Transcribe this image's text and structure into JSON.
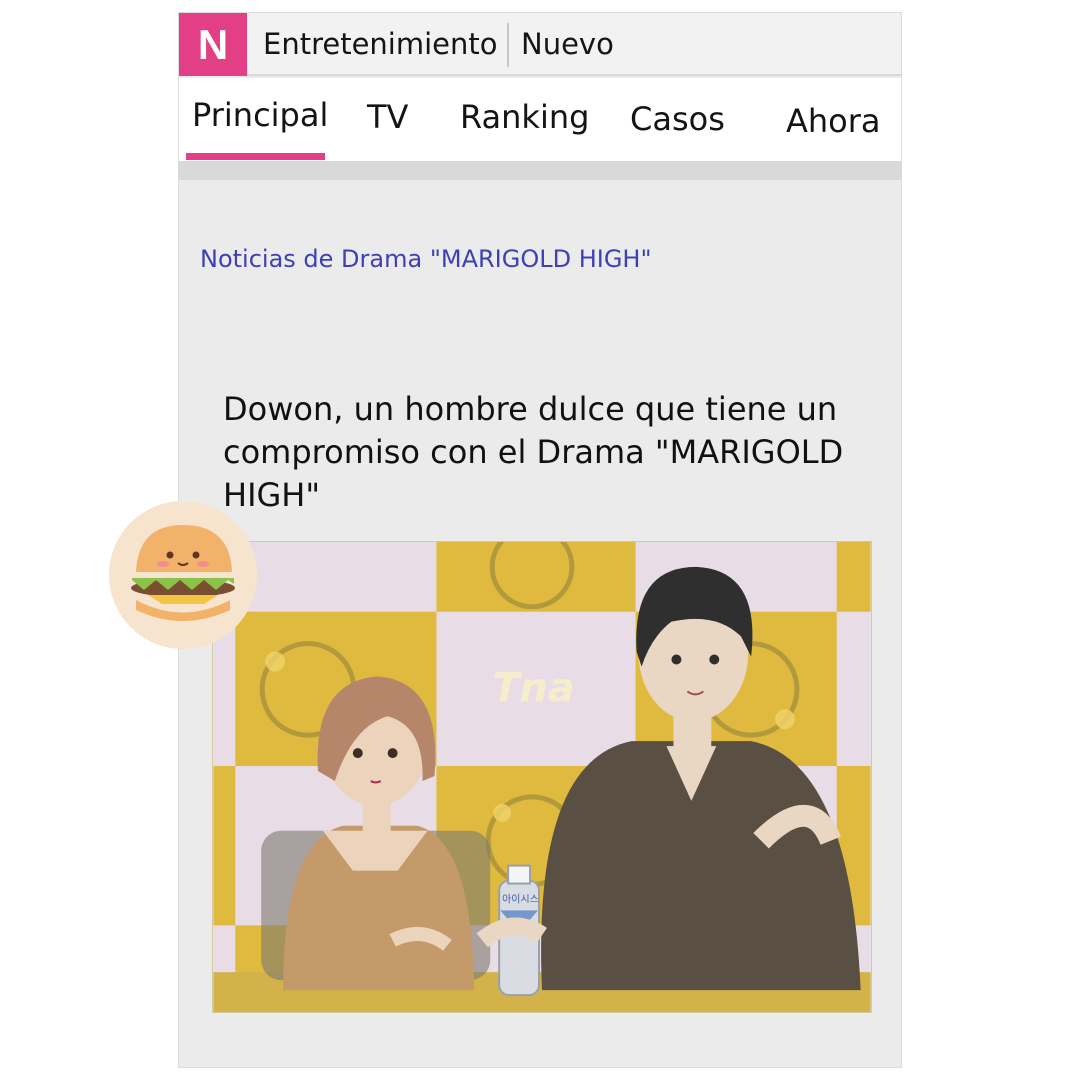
{
  "header": {
    "logo": "N",
    "section": "Entretenimiento",
    "new_label": "Nuevo"
  },
  "tabs": [
    {
      "label": "Principal",
      "active": true
    },
    {
      "label": "TV"
    },
    {
      "label": "Ranking"
    },
    {
      "label": "Casos"
    },
    {
      "label": "Ahora"
    }
  ],
  "article": {
    "category": "Noticias de Drama \"MARIGOLD HIGH\"",
    "headline": "Dowon, un hombre dulce que tiene un compromiso con el Drama \"MARIGOLD HIGH\"",
    "banner_text": "Tna",
    "bottle_label": "아이시스"
  },
  "colors": {
    "brand": "#e33f86",
    "category_link": "#3f3fb4",
    "backdrop_gold": "#e0ba3e",
    "backdrop_pink": "#e8dce6"
  },
  "icons": {
    "sticker": "burger-sticker-icon",
    "logo": "n-logo-icon"
  }
}
